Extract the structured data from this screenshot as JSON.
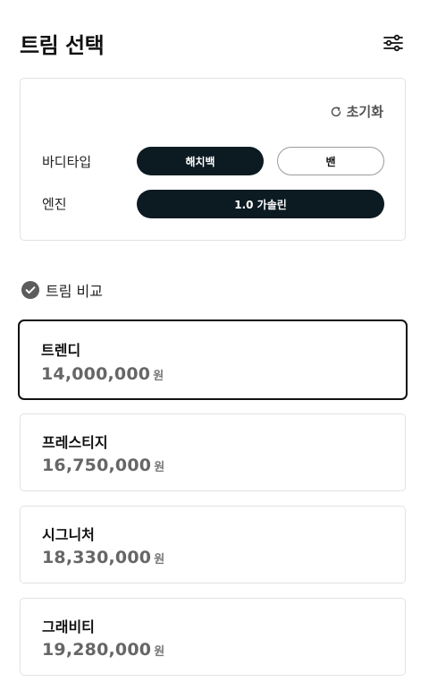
{
  "header": {
    "title": "트림 선택",
    "filter_icon": "sliders-icon"
  },
  "options": {
    "reset_label": "초기화",
    "reset_icon": "refresh-icon",
    "body_type": {
      "label": "바디타입",
      "choices": [
        {
          "label": "해치백",
          "selected": true
        },
        {
          "label": "밴",
          "selected": false
        }
      ]
    },
    "engine": {
      "label": "엔진",
      "choices": [
        {
          "label": "1.0 가솔린",
          "selected": true
        }
      ]
    }
  },
  "compare": {
    "label": "트림 비교",
    "checked": true,
    "icon": "check-circle-icon"
  },
  "trims": [
    {
      "name": "트렌디",
      "price": "14,000,000",
      "unit": "원",
      "selected": true
    },
    {
      "name": "프레스티지",
      "price": "16,750,000",
      "unit": "원",
      "selected": false
    },
    {
      "name": "시그니처",
      "price": "18,330,000",
      "unit": "원",
      "selected": false
    },
    {
      "name": "그래비티",
      "price": "19,280,000",
      "unit": "원",
      "selected": false
    }
  ],
  "colors": {
    "dark_pill": "#0c1a22",
    "border": "#e2e2e2",
    "price": "#666666"
  }
}
